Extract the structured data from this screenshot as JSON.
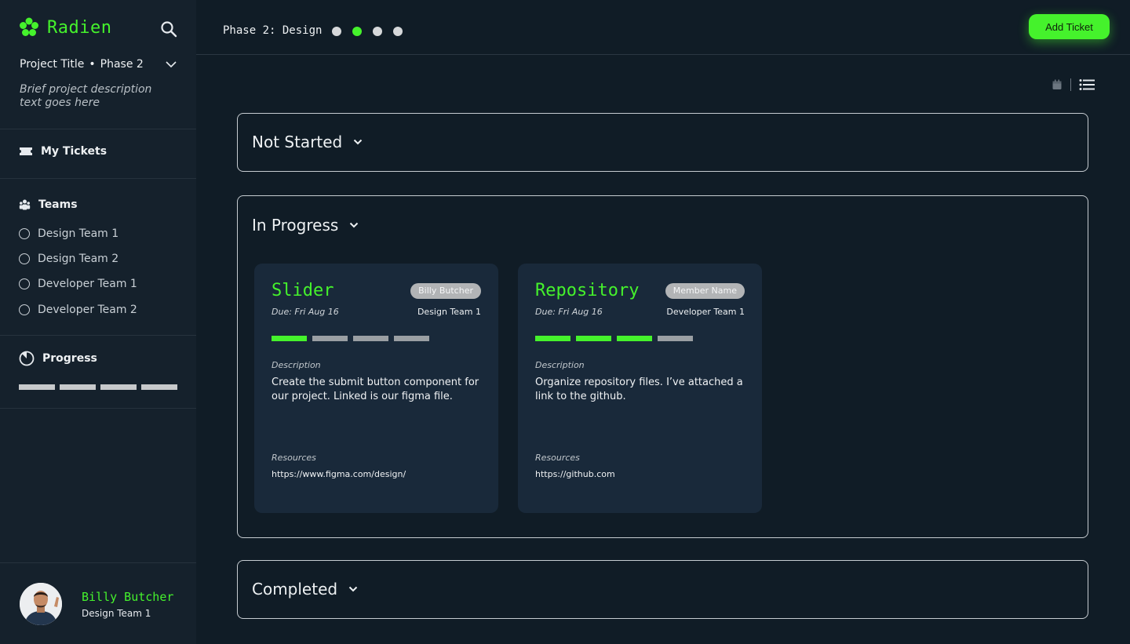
{
  "brand": {
    "name": "Radien",
    "color": "#45f22c"
  },
  "sidebar": {
    "project_title": "Project Title",
    "separator": "•",
    "project_phase": "Phase 2",
    "project_description": "Brief project description text goes here",
    "my_tickets_label": "My Tickets",
    "teams_label": "Teams",
    "teams": [
      "Design Team 1",
      "Design Team 2",
      "Developer Team 1",
      "Developer Team 2"
    ],
    "progress_label": "Progress",
    "progress_segments": [
      0,
      0,
      0,
      0
    ]
  },
  "user": {
    "name": "Billy Butcher",
    "team": "Design Team 1"
  },
  "topbar": {
    "phase_label": "Phase 2: Design",
    "phase_dots": 4,
    "active_phase_index": 1,
    "add_ticket_label": "Add Ticket"
  },
  "view_toggle": {
    "icons": [
      "calendar-icon",
      "list-icon"
    ],
    "active": "list"
  },
  "sections": [
    {
      "title": "Not Started",
      "expanded": false
    },
    {
      "title": "In Progress",
      "expanded": true
    },
    {
      "title": "Completed",
      "expanded": false
    }
  ],
  "tickets": [
    {
      "title": "Slider",
      "assignee": "Billy Butcher",
      "due": "Due: Fri Aug 16",
      "team": "Design Team 1",
      "progress_filled": 1,
      "progress_total": 4,
      "description_label": "Description",
      "description": "Create the submit button component for our project. Linked is our figma file.",
      "resources_label": "Resources",
      "resource_link": "https://www.figma.com/design/"
    },
    {
      "title": "Repository",
      "assignee": "Member Name",
      "due": "Due: Fri Aug 16",
      "team": "Developer Team 1",
      "progress_filled": 3,
      "progress_total": 4,
      "description_label": "Description",
      "description": "Organize repository files. I’ve attached a link to the github.",
      "resources_label": "Resources",
      "resource_link": "https://github.com"
    }
  ],
  "colors": {
    "background": "#101c26",
    "sidebar": "#15212c",
    "card": "#19293a",
    "accent": "#45f22c"
  }
}
